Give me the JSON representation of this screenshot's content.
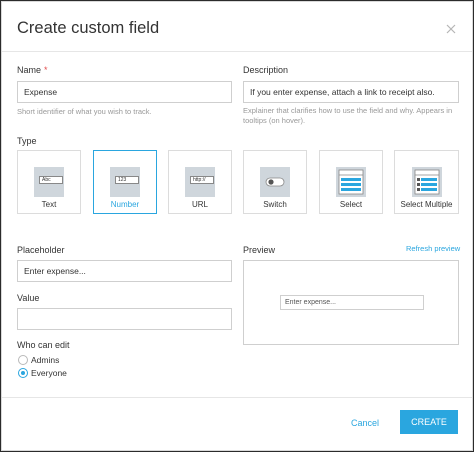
{
  "dialog": {
    "title": "Create custom field",
    "close_icon": "close-icon"
  },
  "fields": {
    "name_label": "Name",
    "name_required_mark": "*",
    "name_value": "Expense",
    "name_help": "Short identifier of what you wish to track.",
    "description_label": "Description",
    "description_value": "If you enter expense, attach a link to receipt also.",
    "description_help_1": "Explainer that clarifies how to use the field and why. Appears in",
    "description_help_2": "tooltips (on hover).",
    "type_label": "Type",
    "placeholder_label": "Placeholder",
    "placeholder_value": "Enter expense...",
    "value_label": "Value",
    "value_value": ""
  },
  "types": [
    {
      "name": "Text",
      "icon": "text-field-icon",
      "glyph": "Abc",
      "selected": false
    },
    {
      "name": "Number",
      "icon": "number-field-icon",
      "glyph": "123",
      "selected": true
    },
    {
      "name": "URL",
      "icon": "url-field-icon",
      "glyph": "http://",
      "selected": false
    },
    {
      "name": "Switch",
      "icon": "switch-icon",
      "glyph": "",
      "selected": false
    },
    {
      "name": "Select",
      "icon": "select-icon",
      "glyph": "",
      "selected": false
    },
    {
      "name": "Select Multiple",
      "icon": "select-multiple-icon",
      "glyph": "",
      "selected": false
    }
  ],
  "preview": {
    "label": "Preview",
    "refresh_label": "Refresh preview",
    "input_placeholder": "Enter expense..."
  },
  "permissions": {
    "label": "Who can edit",
    "options": [
      {
        "label": "Admins",
        "checked": false
      },
      {
        "label": "Everyone",
        "checked": true
      }
    ]
  },
  "footer": {
    "cancel_label": "Cancel",
    "create_label": "CREATE"
  },
  "colors": {
    "accent": "#2aa6df",
    "required": "#e24b4b"
  }
}
